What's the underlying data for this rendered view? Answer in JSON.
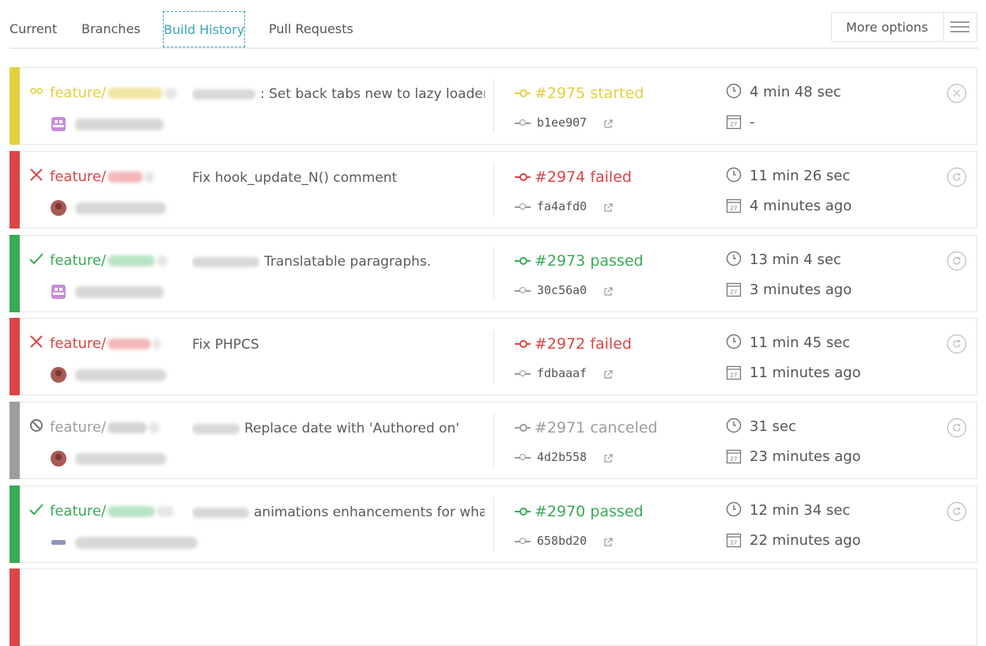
{
  "tabs": [
    "Current",
    "Branches",
    "Build History",
    "Pull Requests"
  ],
  "more_options": "More options",
  "colors": {
    "started": "#e4cf3e",
    "failed": "#db4545",
    "passed": "#39aa56",
    "canceled": "#9d9d9d",
    "accent": "#3ba4b8"
  },
  "builds": [
    {
      "status": "started",
      "branch": "feature/",
      "message": ": Set back tabs new to lazy loader.",
      "build": "#2975 started",
      "sha": "b1ee907",
      "duration": "4 min 48 sec",
      "finished": "-",
      "action_icon": "cancel-icon"
    },
    {
      "status": "failed",
      "branch": "feature/",
      "message": "Fix hook_update_N() comment",
      "build": "#2974 failed",
      "sha": "fa4afd0",
      "duration": "11 min 26 sec",
      "finished": "4 minutes ago",
      "action_icon": "restart-icon"
    },
    {
      "status": "passed",
      "branch": "feature/",
      "message": "Translatable paragraphs.",
      "build": "#2973 passed",
      "sha": "30c56a0",
      "duration": "13 min 4 sec",
      "finished": "3 minutes ago",
      "action_icon": "restart-icon"
    },
    {
      "status": "failed",
      "branch": "feature/",
      "message": "Fix PHPCS",
      "build": "#2972 failed",
      "sha": "fdbaaaf",
      "duration": "11 min 45 sec",
      "finished": "11 minutes ago",
      "action_icon": "restart-icon"
    },
    {
      "status": "canceled",
      "branch": "feature/",
      "message": "Replace date with 'Authored on'",
      "build": "#2971 canceled",
      "sha": "4d2b558",
      "duration": "31 sec",
      "finished": "23 minutes ago",
      "action_icon": "restart-icon"
    },
    {
      "status": "passed",
      "branch": "feature/",
      "message": "animations enhancements for what",
      "build": "#2970 passed",
      "sha": "658bd20",
      "duration": "12 min 34 sec",
      "finished": "22 minutes ago",
      "action_icon": "restart-icon"
    }
  ]
}
